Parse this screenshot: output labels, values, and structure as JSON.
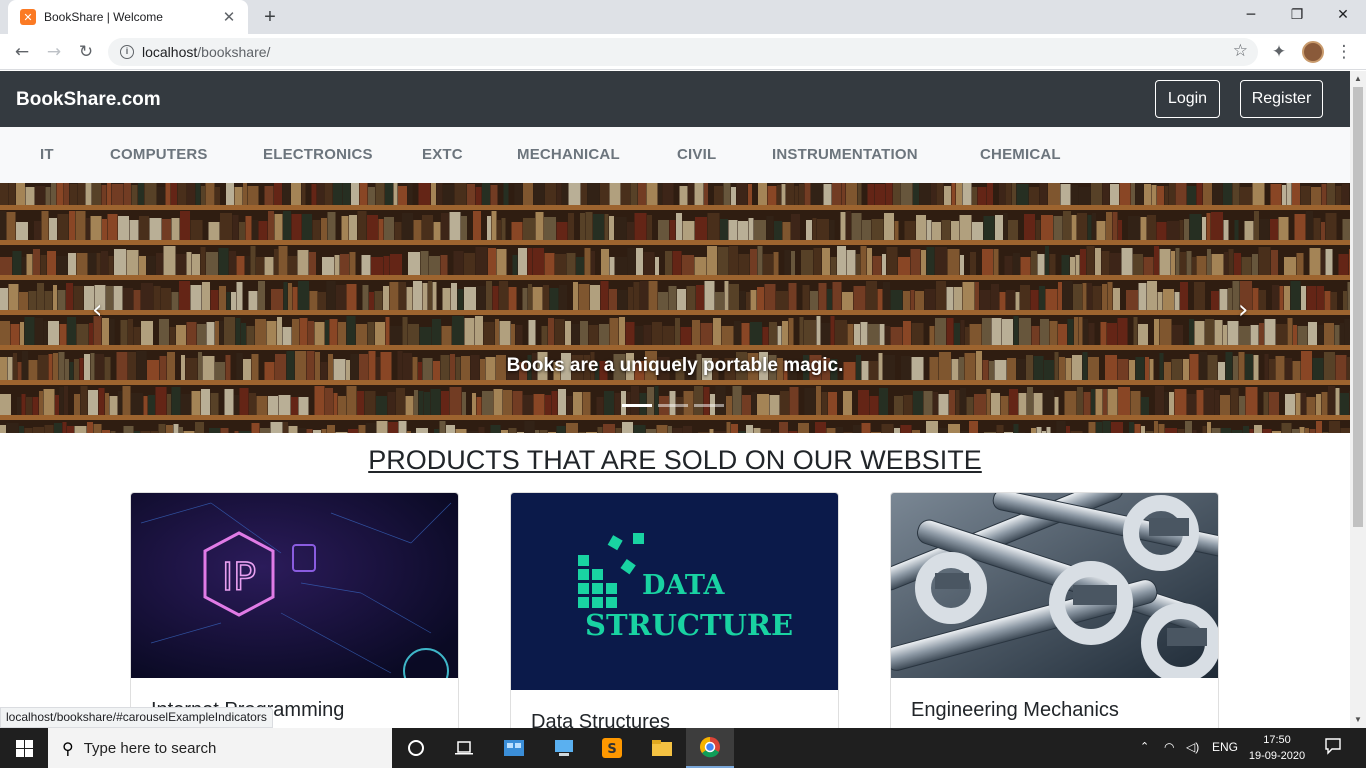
{
  "browser": {
    "tab_title": "BookShare | Welcome",
    "url_host": "localhost",
    "url_path": "/bookshare/",
    "status_url": "localhost/bookshare/#carouselExampleIndicators"
  },
  "site": {
    "brand": "BookShare.com",
    "login_label": "Login",
    "register_label": "Register",
    "categories": [
      "IT",
      "COMPUTERS",
      "ELECTRONICS",
      "EXTC",
      "MECHANICAL",
      "CIVIL",
      "INSTRUMENTATION",
      "CHEMICAL"
    ],
    "carousel_caption": "Books are a uniquely portable magic.",
    "section_heading": "PRODUCTS THAT ARE SOLD ON OUR WEBSITE",
    "cards": [
      {
        "title": "Internet Programming",
        "image_text": "IP"
      },
      {
        "title": "Data Structures",
        "image_text_1": "DATA",
        "image_text_2": "STRUCTURE"
      },
      {
        "title": "Engineering Mechanics"
      }
    ]
  },
  "taskbar": {
    "search_placeholder": "Type here to search",
    "language": "ENG",
    "time": "17:50",
    "date": "19-09-2020"
  },
  "colors": {
    "navbar": "#343a40",
    "catbar": "#f8f9fa",
    "taskbar": "#1f1f1f",
    "ds_bg": "#0b1a4a",
    "ds_accent": "#19d3a2"
  }
}
